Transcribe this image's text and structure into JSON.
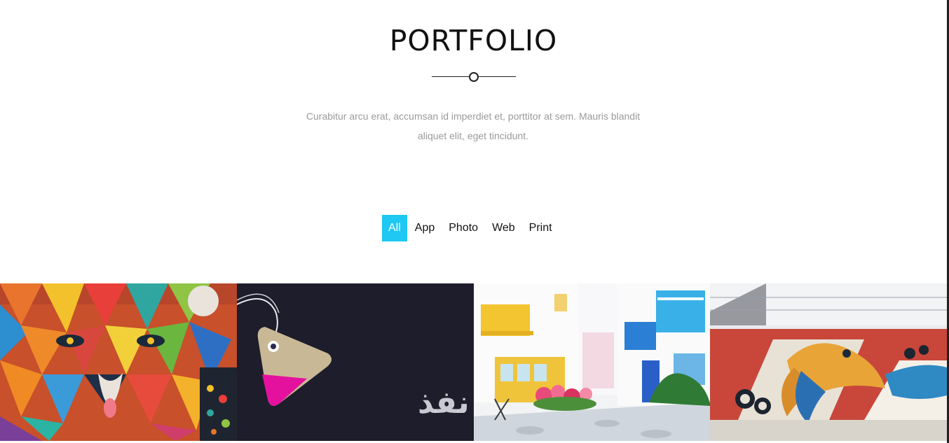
{
  "section": {
    "title": "PORTFOLIO",
    "subtitle_line1": "Curabitur arcu erat, accumsan id imperdiet et, porttitor at sem. Mauris blandit",
    "subtitle_line2": "aliquet elit, eget tincidunt."
  },
  "filters": {
    "items": [
      {
        "label": "All",
        "active": true
      },
      {
        "label": "App",
        "active": false
      },
      {
        "label": "Photo",
        "active": false
      },
      {
        "label": "Web",
        "active": false
      },
      {
        "label": "Print",
        "active": false
      }
    ]
  },
  "gallery": {
    "items": [
      {
        "name": "colorful-geometric-bear-mural"
      },
      {
        "name": "price-tag-on-dark-background"
      },
      {
        "name": "white-street-with-blue-balconies"
      },
      {
        "name": "painted-fish-bird-wall-mural"
      }
    ]
  },
  "watermark": {
    "text": "nafez"
  },
  "colors": {
    "accent": "#1ec8f2",
    "title": "#111111",
    "subtitle": "#9a9a9a"
  }
}
